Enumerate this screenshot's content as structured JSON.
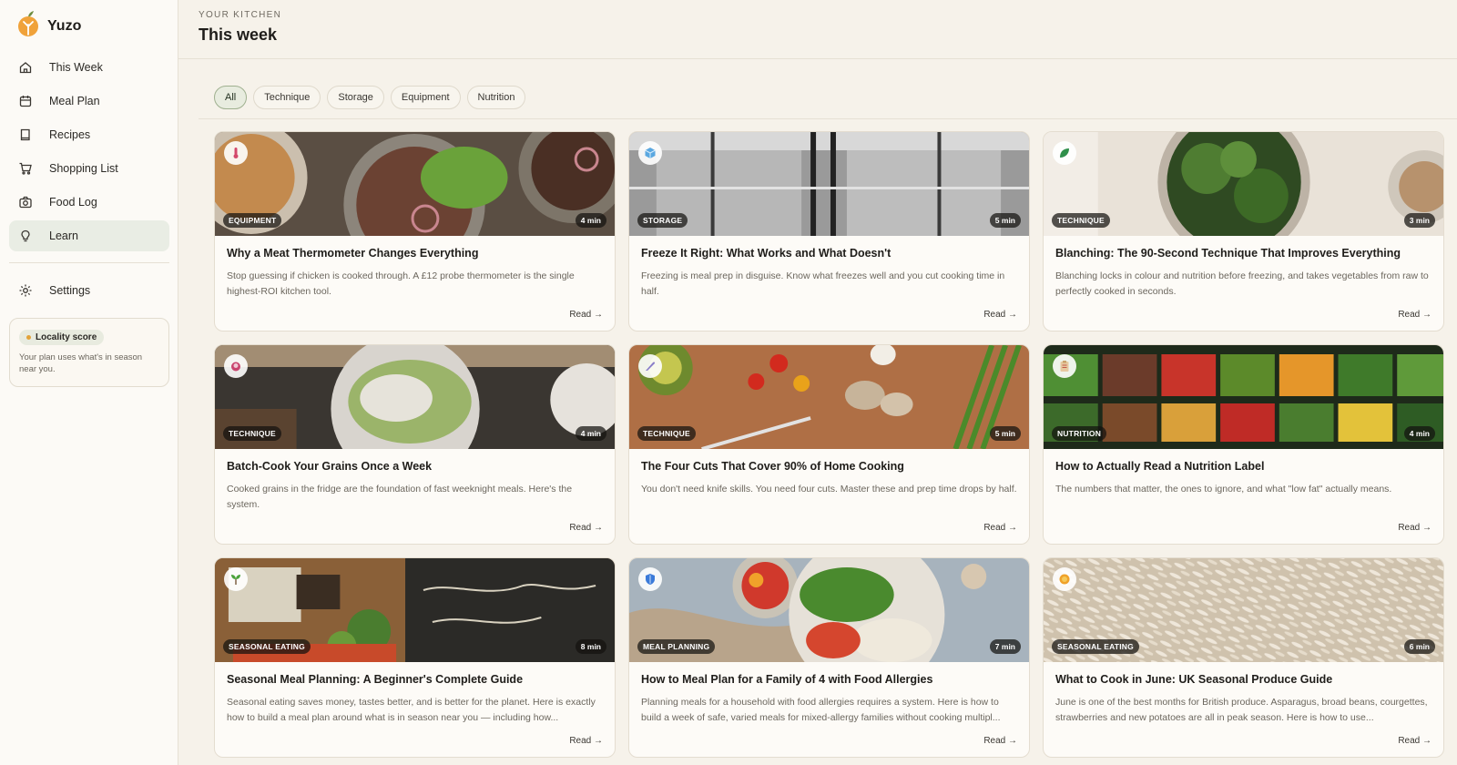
{
  "brand": {
    "name": "Yuzo",
    "accent": "#f0a23a"
  },
  "nav": {
    "items": [
      {
        "label": "This Week",
        "icon": "home-icon"
      },
      {
        "label": "Meal Plan",
        "icon": "calendar-icon"
      },
      {
        "label": "Recipes",
        "icon": "book-icon"
      },
      {
        "label": "Shopping List",
        "icon": "cart-icon"
      },
      {
        "label": "Food Log",
        "icon": "camera-icon"
      },
      {
        "label": "Learn",
        "icon": "lightbulb-icon",
        "active": true
      }
    ],
    "settings_label": "Settings"
  },
  "locality": {
    "pill": "Locality score",
    "text": "Your plan uses what's in season near you."
  },
  "header": {
    "eyebrow": "YOUR KITCHEN",
    "title": "This week"
  },
  "filters": [
    {
      "label": "All",
      "active": true
    },
    {
      "label": "Technique"
    },
    {
      "label": "Storage"
    },
    {
      "label": "Equipment"
    },
    {
      "label": "Nutrition"
    }
  ],
  "read_label": "Read →",
  "articles": [
    {
      "category": "EQUIPMENT",
      "duration": "4 min",
      "icon": "thermometer-icon",
      "title": "Why a Meat Thermometer Changes Everything",
      "description": "Stop guessing if chicken is cooked through. A £12 probe thermometer is the single highest-ROI kitchen tool."
    },
    {
      "category": "STORAGE",
      "duration": "5 min",
      "icon": "ice-cube-icon",
      "title": "Freeze It Right: What Works and What Doesn't",
      "description": "Freezing is meal prep in disguise. Know what freezes well and you cut cooking time in half."
    },
    {
      "category": "TECHNIQUE",
      "duration": "3 min",
      "icon": "leaf-icon",
      "title": "Blanching: The 90-Second Technique That Improves Everything",
      "description": "Blanching locks in colour and nutrition before freezing, and takes vegetables from raw to perfectly cooked in seconds."
    },
    {
      "category": "TECHNIQUE",
      "duration": "4 min",
      "icon": "bowl-icon",
      "title": "Batch-Cook Your Grains Once a Week",
      "description": "Cooked grains in the fridge are the foundation of fast weeknight meals. Here's the system."
    },
    {
      "category": "TECHNIQUE",
      "duration": "5 min",
      "icon": "knife-icon",
      "title": "The Four Cuts That Cover 90% of Home Cooking",
      "description": "You don't need knife skills. You need four cuts. Master these and prep time drops by half."
    },
    {
      "category": "NUTRITION",
      "duration": "4 min",
      "icon": "clipboard-icon",
      "title": "How to Actually Read a Nutrition Label",
      "description": "The numbers that matter, the ones to ignore, and what \"low fat\" actually means."
    },
    {
      "category": "SEASONAL EATING",
      "duration": "8 min",
      "icon": "seedling-icon",
      "title": "Seasonal Meal Planning: A Beginner's Complete Guide",
      "description": "Seasonal eating saves money, tastes better, and is better for the planet. Here is exactly how to build a meal plan around what is in season near you — including how..."
    },
    {
      "category": "MEAL PLANNING",
      "duration": "7 min",
      "icon": "shield-icon",
      "title": "How to Meal Plan for a Family of 4 with Food Allergies",
      "description": "Planning meals for a household with food allergies requires a system. Here is how to build a week of safe, varied meals for mixed-allergy families without cooking multipl..."
    },
    {
      "category": "SEASONAL EATING",
      "duration": "6 min",
      "icon": "sun-icon",
      "title": "What to Cook in June: UK Seasonal Produce Guide",
      "description": "June is one of the best months for British produce. Asparagus, broad beans, courgettes, strawberries and new potatoes are all in peak season. Here is how to use..."
    }
  ]
}
